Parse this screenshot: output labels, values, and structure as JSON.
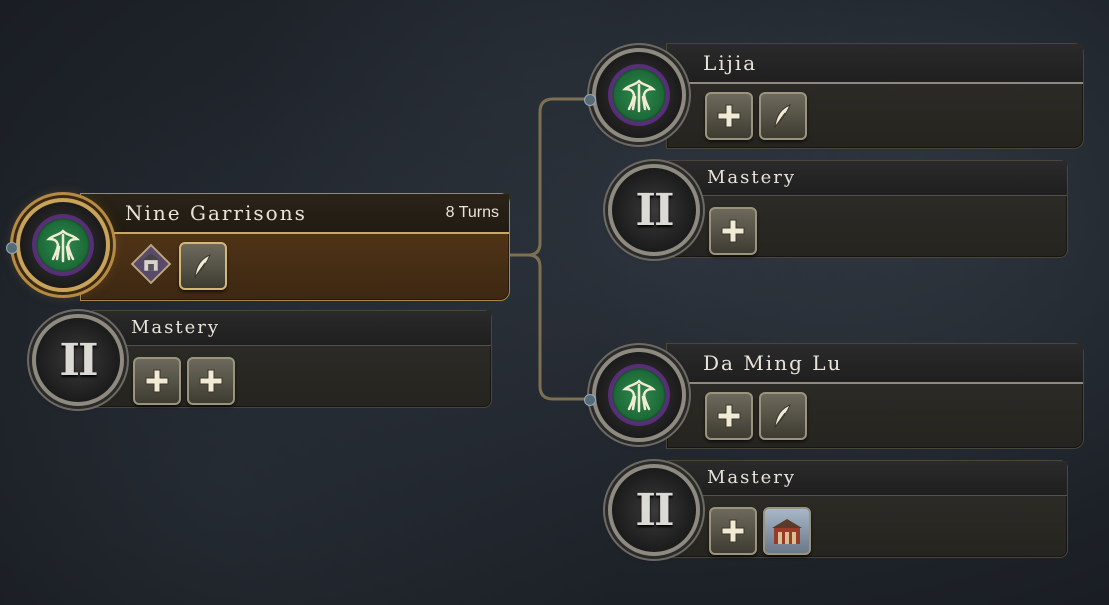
{
  "tree": {
    "root": {
      "title": "Nine Garrisons",
      "turns": "8 Turns",
      "icons": [
        "pagoda-diamond-icon",
        "feather-plus-icon"
      ]
    },
    "root_mastery": {
      "numeral": "II",
      "title": "Mastery",
      "icons": [
        "plus-icon",
        "plus-icon"
      ]
    },
    "branch_top": {
      "title": "Lijia",
      "icons": [
        "plus-icon",
        "feather-plus-icon"
      ]
    },
    "branch_top_mastery": {
      "numeral": "II",
      "title": "Mastery",
      "icons": [
        "plus-icon"
      ]
    },
    "branch_bottom": {
      "title": "Da Ming Lu",
      "icons": [
        "plus-icon",
        "feather-plus-icon"
      ]
    },
    "branch_bottom_mastery": {
      "numeral": "II",
      "title": "Mastery",
      "icons": [
        "plus-icon",
        "palace-icon"
      ]
    }
  },
  "colors": {
    "active_accent": "#c9a35a",
    "panel": "#2f2e2a",
    "emblem_green": "#2f8a4c",
    "emblem_purple": "#5a2f7a",
    "text": "#e8e4da"
  }
}
